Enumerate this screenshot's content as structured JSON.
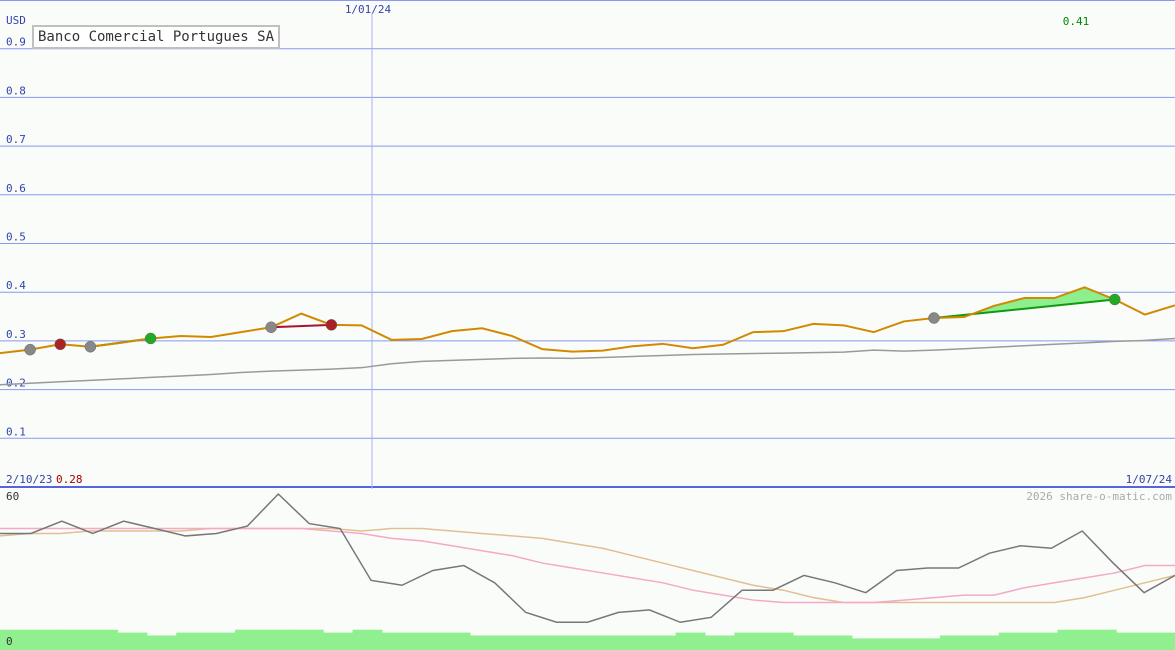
{
  "chart_data": [
    {
      "type": "line",
      "title": "Banco Comercial Portugues SA",
      "ylabel": "USD",
      "ylim": [
        0,
        1.0
      ],
      "y_ticks": [
        "0.1",
        "0.2",
        "0.3",
        "0.4",
        "0.5",
        "0.6",
        "0.7",
        "0.8",
        "0.9"
      ],
      "x_start_label": "2/10/23",
      "x_mid_label": "1/01/24",
      "x_end_label": "1/07/24",
      "low_label": "0.28",
      "high_label": "0.41",
      "grid": true,
      "series": [
        {
          "values": [
            0.275,
            0.282,
            0.293,
            0.288,
            0.296,
            0.305,
            0.31,
            0.308,
            0.318,
            0.328,
            0.356,
            0.333,
            0.332,
            0.302,
            0.304,
            0.32,
            0.326,
            0.31,
            0.283,
            0.278,
            0.28,
            0.289,
            0.294,
            0.285,
            0.292,
            0.318,
            0.32,
            0.335,
            0.332,
            0.318,
            0.34,
            0.347,
            0.349,
            0.372,
            0.388,
            0.388,
            0.41,
            0.385,
            0.354,
            0.373
          ]
        },
        {
          "values": [
            0.21,
            0.213,
            0.216,
            0.219,
            0.222,
            0.225,
            0.228,
            0.231,
            0.235,
            0.238,
            0.24,
            0.242,
            0.245,
            0.253,
            0.258,
            0.26,
            0.262,
            0.264,
            0.265,
            0.264,
            0.266,
            0.268,
            0.27,
            0.272,
            0.273,
            0.274,
            0.275,
            0.276,
            0.277,
            0.281,
            0.279,
            0.281,
            0.284,
            0.287,
            0.29,
            0.293,
            0.296,
            0.299,
            0.301,
            0.305
          ]
        }
      ],
      "markers": [
        {
          "i": 1,
          "kind": "grey"
        },
        {
          "i": 2,
          "kind": "red"
        },
        {
          "i": 3,
          "kind": "grey"
        },
        {
          "i": 5,
          "kind": "green"
        },
        {
          "i": 9,
          "kind": "grey"
        },
        {
          "i": 11,
          "kind": "red"
        },
        {
          "i": 31,
          "kind": "grey"
        },
        {
          "i": 37,
          "kind": "green"
        }
      ],
      "colors": {
        "price": "#d18a00",
        "ma": "#999999",
        "grid": "#8899ee",
        "tick_text": "#3344aa",
        "high": "#008800",
        "low": "#aa0000",
        "gain_fill": "#88ee88",
        "loss_fill": "#f0a0c0"
      }
    },
    {
      "type": "line",
      "ylim": [
        0,
        60
      ],
      "y_ticks": [
        "0",
        "60"
      ],
      "copyright": "2026 share-o-matic.com",
      "series": [
        {
          "values": [
            44,
            44,
            49,
            44,
            49,
            46,
            43,
            44,
            47,
            60,
            48,
            46,
            25,
            23,
            29,
            31,
            24,
            12,
            8,
            8,
            12,
            13,
            8,
            10,
            21,
            21,
            27,
            24,
            20,
            29,
            30,
            30,
            36,
            39,
            38,
            45,
            32,
            20,
            27
          ]
        },
        {
          "values": [
            46,
            46,
            46,
            46,
            46,
            46,
            46,
            46,
            46,
            46,
            46,
            45,
            44,
            42,
            41,
            39,
            37,
            35,
            32,
            30,
            28,
            26,
            24,
            21,
            19,
            17,
            16,
            16,
            16,
            16,
            17,
            18,
            19,
            19,
            22,
            24,
            26,
            28,
            31,
            31
          ]
        },
        {
          "values": [
            43,
            44,
            44,
            45,
            45,
            45,
            45,
            46,
            46,
            46,
            46,
            46,
            45,
            46,
            46,
            45,
            44,
            43,
            42,
            40,
            38,
            35,
            32,
            29,
            26,
            23,
            21,
            18,
            16,
            16,
            16,
            16,
            16,
            16,
            16,
            16,
            18,
            21,
            24,
            27
          ]
        },
        {
          "values": [
            7,
            7,
            7,
            7,
            6,
            5,
            6,
            6,
            7,
            7,
            7,
            6,
            7,
            6,
            6,
            6,
            5,
            5,
            5,
            5,
            5,
            5,
            5,
            6,
            5,
            6,
            6,
            5,
            5,
            4,
            4,
            4,
            5,
            5,
            6,
            6,
            7,
            7,
            6,
            6
          ]
        }
      ],
      "colors": {
        "s1": "#777777",
        "s2": "#f5a8c8",
        "s3": "#e0c090",
        "volume": "#90f090"
      }
    }
  ]
}
